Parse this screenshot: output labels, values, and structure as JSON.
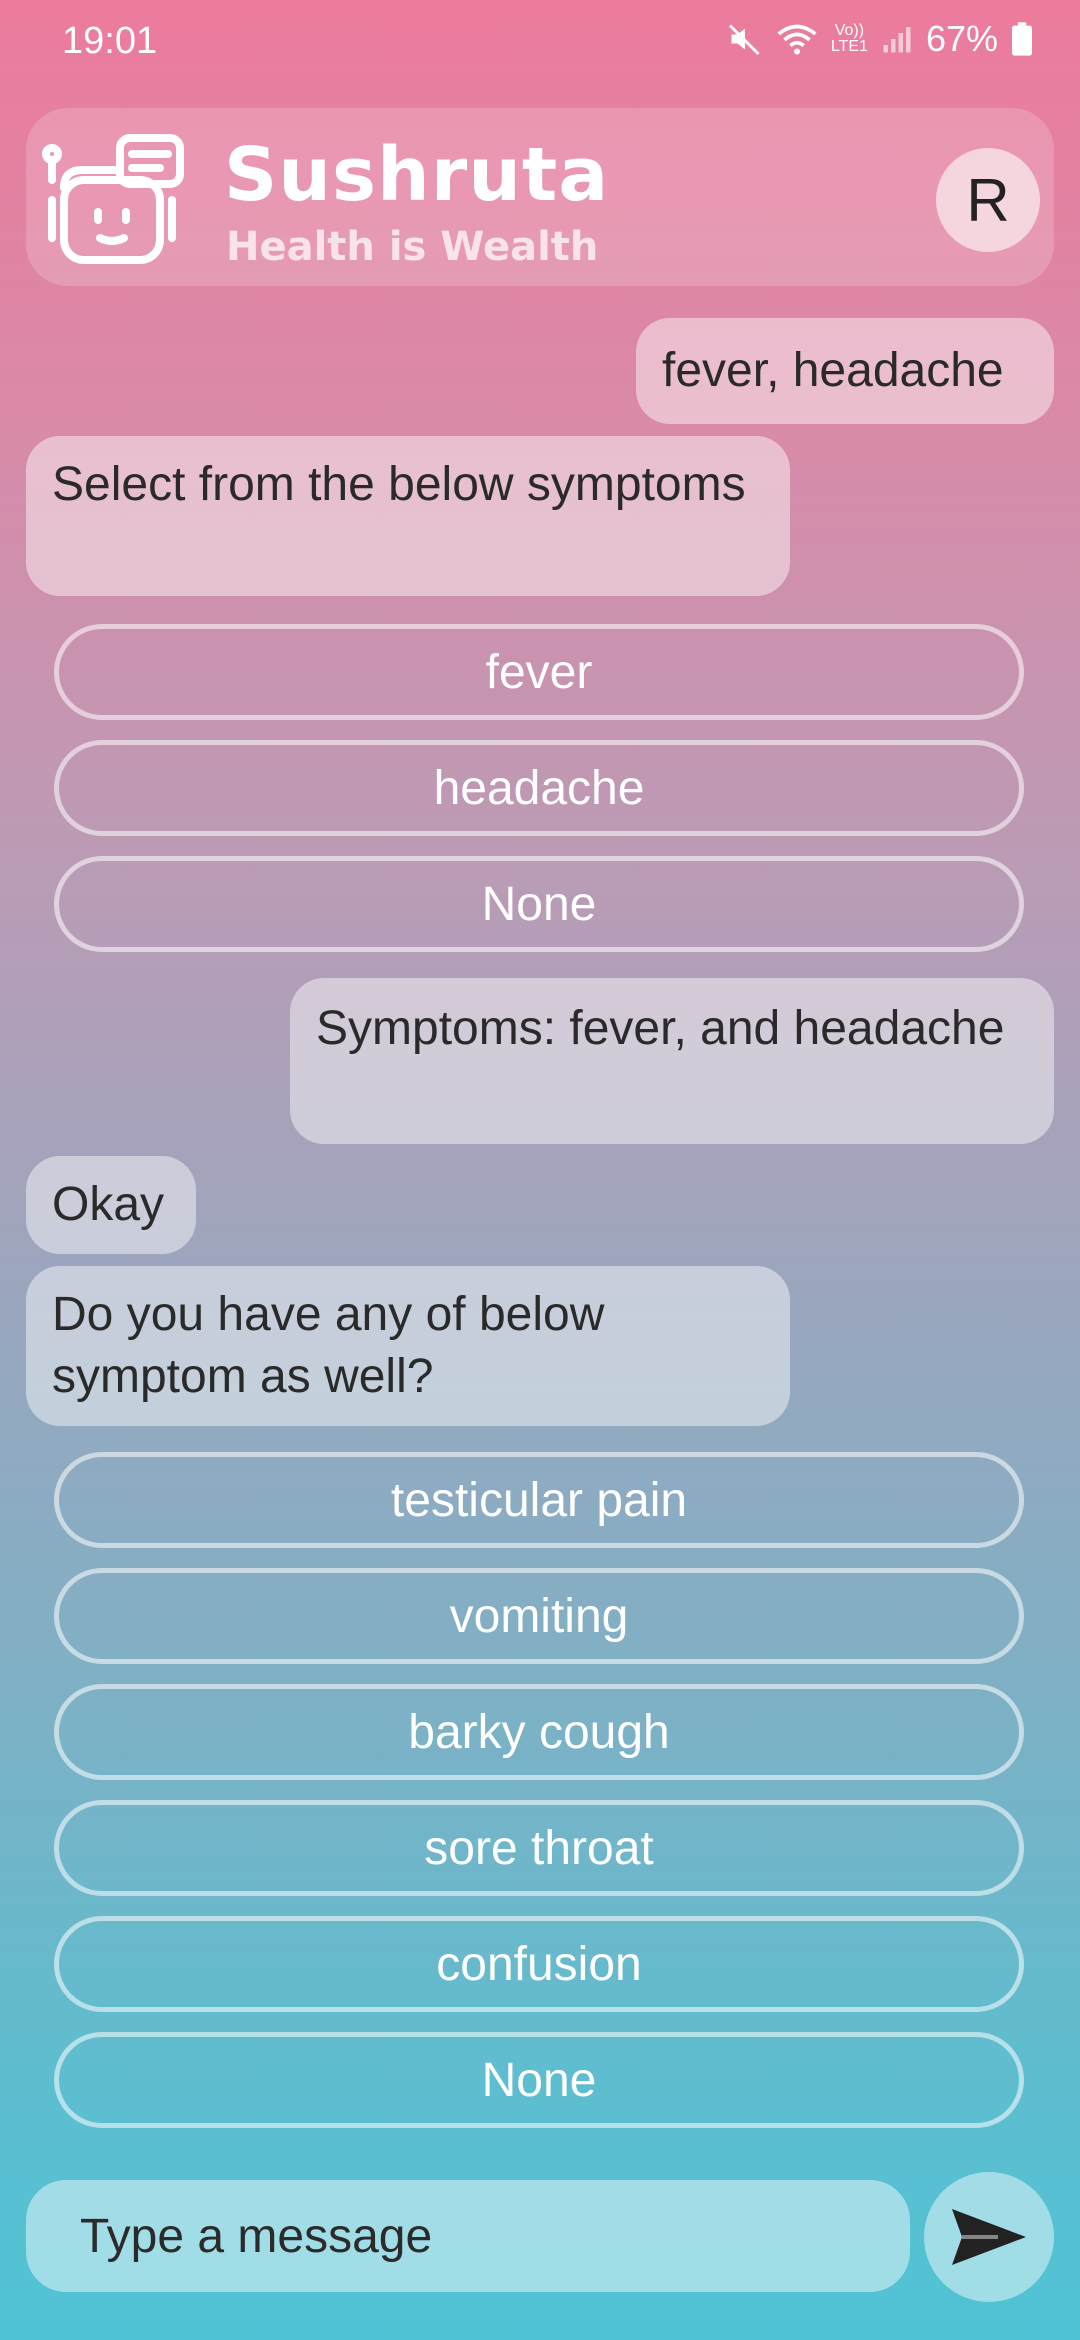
{
  "status_bar": {
    "time": "19:01",
    "battery": "67%",
    "network_top": "Vo))",
    "network_bottom": "LTE1"
  },
  "header": {
    "title": "Sushruta",
    "subtitle": "Health is Wealth",
    "avatar_letter": "R"
  },
  "messages": [
    {
      "sender": "user",
      "text": "fever, headache"
    },
    {
      "sender": "bot",
      "text": "Select from the below symptoms",
      "options": [
        "fever",
        "headache",
        "None"
      ]
    },
    {
      "sender": "user",
      "text": "Symptoms: fever, and headache"
    },
    {
      "sender": "bot",
      "text": "Okay"
    },
    {
      "sender": "bot",
      "text": "Do you have any of below symptom as well?",
      "options": [
        "testicular pain",
        "vomiting",
        "barky cough",
        "sore throat",
        "confusion",
        "None"
      ]
    }
  ],
  "input": {
    "placeholder": "Type a message"
  },
  "icons": {
    "robot": "robot-chat-icon",
    "send": "send-icon",
    "mute": "mute-icon",
    "wifi": "wifi-icon",
    "signal": "signal-icon",
    "battery": "battery-icon"
  }
}
